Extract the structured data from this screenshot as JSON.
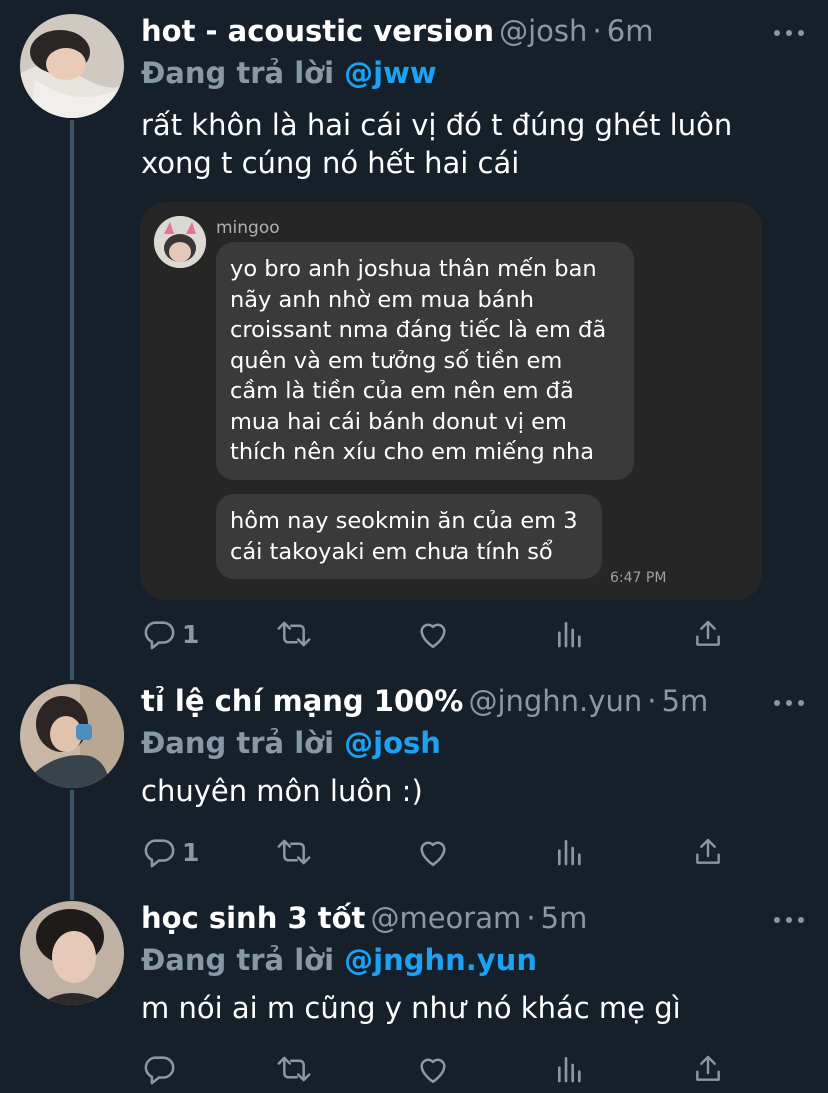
{
  "tweets": [
    {
      "display_name": "hot - acoustic version",
      "handle": "@josh",
      "time": "6m",
      "reply_prefix": "Đang trả lời",
      "reply_to": "@jww",
      "text": "rất khôn là hai cái vị đó t đúng ghét luôn\nxong t cúng nó hết hai cái",
      "reply_count": "1",
      "embed": {
        "sender": "mingoo",
        "messages": [
          "yo bro anh joshua thân mến ban\nnãy anh nhờ em mua bánh\ncroissant nma đáng tiếc là em đã\nquên và em tưởng số tiền em\ncầm là tiền của em nên em đã\nmua hai cái bánh donut vị em\nthích nên xíu cho em miếng nha",
          "hôm nay seokmin ăn của em 3\ncái takoyaki em chưa tính sổ"
        ],
        "time": "6:47 PM"
      }
    },
    {
      "display_name": "tỉ lệ chí mạng 100%",
      "handle": "@jnghn.yun",
      "time": "5m",
      "reply_prefix": "Đang trả lời",
      "reply_to": "@josh",
      "text": "chuyên môn luôn :)",
      "reply_count": "1"
    },
    {
      "display_name": "học sinh 3 tốt",
      "handle": "@meoram",
      "time": "5m",
      "reply_prefix": "Đang trả lời",
      "reply_to": "@jnghn.yun",
      "text": "m nói ai m cũng y như nó khác mẹ gì",
      "reply_count": ""
    }
  ],
  "separator": "·",
  "colors": {
    "background": "#15202b",
    "secondary_text": "#8899a6",
    "mention": "#1da1f2",
    "thread_line": "#3d5466"
  },
  "icons": [
    "reply-icon",
    "retweet-icon",
    "like-icon",
    "analytics-icon",
    "share-icon",
    "more-icon"
  ]
}
